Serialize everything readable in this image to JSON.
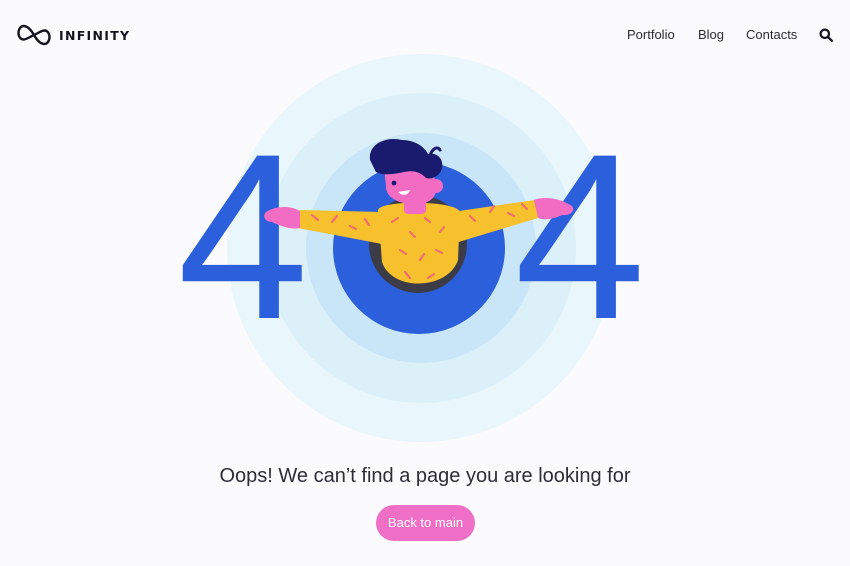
{
  "header": {
    "brand": "INFINITY",
    "nav": [
      {
        "label": "Portfolio"
      },
      {
        "label": "Blog"
      },
      {
        "label": "Contacts"
      }
    ],
    "search_icon": "search-icon"
  },
  "error": {
    "code_left": "4",
    "code_right": "4",
    "message": "Oops! We can’t find a page you are looking for",
    "button_label": "Back to main"
  },
  "colors": {
    "accent_blue": "#2c5fdb",
    "button_pink": "#f06fc6",
    "ring_light": "#e6f5fb",
    "ring_mid": "#d5ecf8",
    "ring_inner": "#c4e2f6",
    "sweater_yellow": "#f6c12c",
    "skin_pink": "#f36cc4",
    "hair_navy": "#1a1a6e"
  }
}
